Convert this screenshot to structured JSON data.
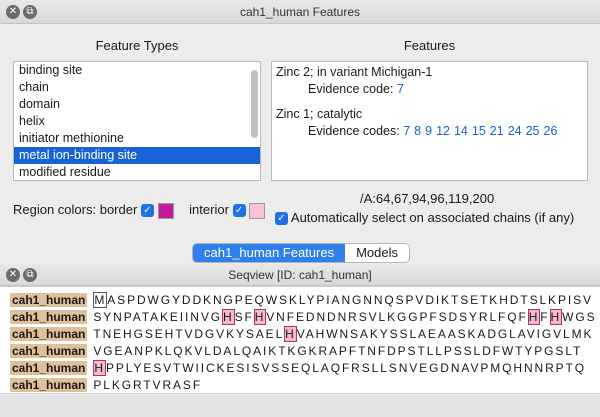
{
  "top_window": {
    "title": "cah1_human Features",
    "feature_types_label": "Feature Types",
    "features_label": "Features",
    "feature_types": [
      "binding site",
      "chain",
      "domain",
      "helix",
      "initiator methionine",
      "metal ion-binding site",
      "modified residue"
    ],
    "selected_index": 5,
    "features": [
      {
        "label": "Zinc 2; in variant Michigan-1",
        "evidence_prefix": "Evidence code:",
        "codes": [
          "7"
        ]
      },
      {
        "label": "Zinc 1; catalytic",
        "evidence_prefix": "Evidence codes:",
        "codes": [
          "7",
          "8",
          "9",
          "12",
          "14",
          "15",
          "21",
          "24",
          "25",
          "26"
        ]
      }
    ],
    "region_colors_label": "Region colors: border",
    "interior_label": "interior",
    "border_color": "#c41a9a",
    "interior_color": "#f8c3d8",
    "positions": "/A:64,67,94,96,119,200",
    "auto_select_label": "Automatically select on associated chains (if any)"
  },
  "tabs": [
    "cah1_human Features",
    "Models"
  ],
  "seqview": {
    "title": "Seqview [ID: cah1_human]",
    "name": "cah1_human",
    "rows": [
      [
        {
          "t": "M",
          "c": "cur"
        },
        {
          "t": "ASPDWGYDDKNGPEQWSKLYPIANGNNQSPVDIKTSETKHDTSLKPISV"
        }
      ],
      [
        {
          "t": "SYNPATAKEIINVG"
        },
        {
          "t": "H",
          "c": "hl"
        },
        {
          "t": "SF"
        },
        {
          "t": "H",
          "c": "hl"
        },
        {
          "t": "VNFEDNDNRSVLKGGPFSDSYRLFQF"
        },
        {
          "t": "H",
          "c": "hl"
        },
        {
          "t": "F"
        },
        {
          "t": "H",
          "c": "hl"
        },
        {
          "t": "WGS"
        }
      ],
      [
        {
          "t": "TNEHGSEHTVDGVKYSAEL"
        },
        {
          "t": "H",
          "c": "hl"
        },
        {
          "t": "VAHWNSAKYSSLAEAASKADGLAVIGVLMK"
        }
      ],
      [
        {
          "t": "VGEANPKLQKVLDALQAIKTKGKRAPFTNFDPSTLLPSSLDFWTYPGSLT"
        }
      ],
      [
        {
          "t": "H",
          "c": "hl"
        },
        {
          "t": "PPLYESVTWIICKESISVSSEQLAQFRSLLSNVEGDNAVPMQHNNRPTQ"
        }
      ],
      [
        {
          "t": "PLKGRTVRASF"
        }
      ]
    ]
  }
}
